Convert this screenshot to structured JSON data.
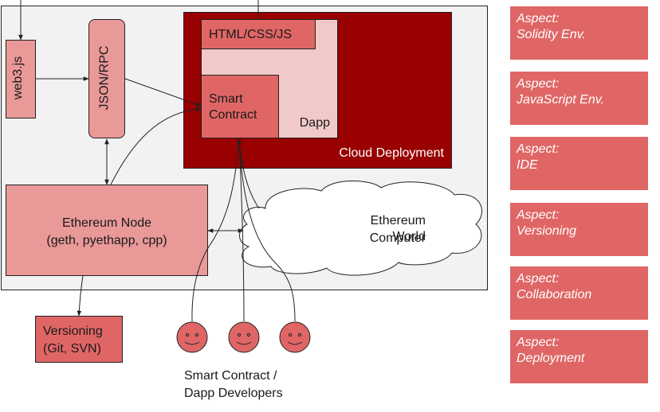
{
  "diagram": {
    "containers": {
      "cloud_deployment": "Cloud Deployment",
      "dapp": "Dapp"
    },
    "nodes": {
      "html_css_js": "HTML/CSS/JS",
      "smart_contract_line1": "Smart",
      "smart_contract_line2": "Contract",
      "web3js": "web3.js",
      "json_rpc": "JSON/RPC",
      "ethereum_node_line1": "Ethereum Node",
      "ethereum_node_line2": "(geth, pyethapp, cpp)",
      "world_computer_line1": "Ethereum World",
      "world_computer_line2": "Computer",
      "versioning_line1": "Versioning",
      "versioning_line2": "(Git, SVN)",
      "developers_line1": "Smart Contract /",
      "developers_line2": "Dapp Developers"
    },
    "developer_count": 3,
    "aspects": [
      {
        "label": "Aspect:",
        "value": "Solidity Env."
      },
      {
        "label": "Aspect:",
        "value": "JavaScript Env."
      },
      {
        "label": "Aspect:",
        "value": "IDE"
      },
      {
        "label": "Aspect:",
        "value": "Versioning"
      },
      {
        "label": "Aspect:",
        "value": "Collaboration"
      },
      {
        "label": "Aspect:",
        "value": "Deployment"
      }
    ],
    "colors": {
      "cloud": "#990000",
      "dapp": "#f2c9c9",
      "dark_red_box": "#e06666",
      "light_red_box": "#ea9999",
      "background_panel": "#f2f2f2"
    }
  }
}
